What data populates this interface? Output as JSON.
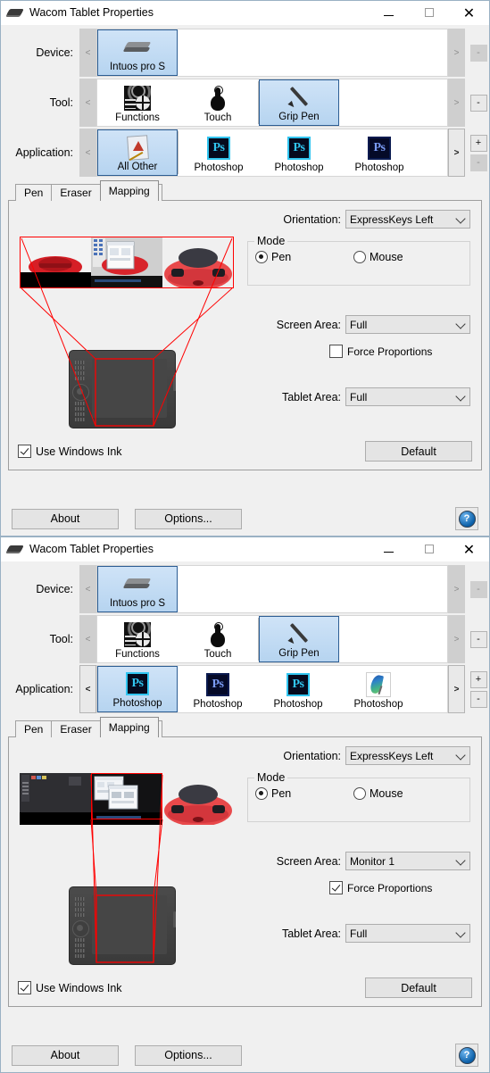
{
  "window": {
    "title": "Wacom Tablet Properties",
    "icon": "tablet-icon",
    "minimize": "—",
    "maximize": "",
    "close": "✕"
  },
  "selectors": {
    "device_label": "Device:",
    "tool_label": "Tool:",
    "application_label": "Application:",
    "prev_arrow": "<",
    "next_arrow": ">",
    "plus": "+",
    "minus": "-"
  },
  "win1": {
    "device_items": [
      {
        "label": "Intuos pro S",
        "icon": "tablet-icon",
        "selected": true
      }
    ],
    "tool_items": [
      {
        "label": "Functions",
        "icon": "functions-icon",
        "selected": false
      },
      {
        "label": "Touch",
        "icon": "touch-icon",
        "selected": false
      },
      {
        "label": "Grip Pen",
        "icon": "pen-icon",
        "selected": true
      }
    ],
    "application_items": [
      {
        "label": "All Other",
        "icon": "all-other-icon",
        "selected": true
      },
      {
        "label": "Photoshop",
        "icon": "photoshop-icon",
        "selected": false
      },
      {
        "label": "Photoshop",
        "icon": "photoshop-icon",
        "selected": false
      },
      {
        "label": "Photoshop",
        "icon": "photoshop-dark-icon",
        "selected": false
      }
    ],
    "tabs": [
      {
        "label": "Pen",
        "active": false
      },
      {
        "label": "Eraser",
        "active": false
      },
      {
        "label": "Mapping",
        "active": true
      }
    ],
    "orientation_label": "Orientation:",
    "orientation_value": "ExpressKeys Left",
    "mode_label": "Mode",
    "mode_pen": "Pen",
    "mode_mouse": "Mouse",
    "mode_selected": "Pen",
    "screen_area_label": "Screen Area:",
    "screen_area_value": "Full",
    "force_proportions_label": "Force Proportions",
    "force_proportions_checked": false,
    "tablet_area_label": "Tablet Area:",
    "tablet_area_value": "Full",
    "use_windows_ink_label": "Use Windows Ink",
    "use_windows_ink_checked": true,
    "default_button": "Default",
    "about_button": "About",
    "options_button": "Options...",
    "help_button": "?"
  },
  "win2": {
    "device_items": [
      {
        "label": "Intuos pro S",
        "icon": "tablet-icon",
        "selected": true
      }
    ],
    "tool_items": [
      {
        "label": "Functions",
        "icon": "functions-icon",
        "selected": false
      },
      {
        "label": "Touch",
        "icon": "touch-icon",
        "selected": false
      },
      {
        "label": "Grip Pen",
        "icon": "pen-icon",
        "selected": true
      }
    ],
    "application_items": [
      {
        "label": "Photoshop",
        "icon": "photoshop-icon",
        "selected": true
      },
      {
        "label": "Photoshop",
        "icon": "photoshop-dark-icon",
        "selected": false
      },
      {
        "label": "Photoshop",
        "icon": "photoshop-icon",
        "selected": false
      },
      {
        "label": "Photoshop",
        "icon": "feather-icon",
        "selected": false
      }
    ],
    "tabs": [
      {
        "label": "Pen",
        "active": false
      },
      {
        "label": "Eraser",
        "active": false
      },
      {
        "label": "Mapping",
        "active": true
      }
    ],
    "orientation_label": "Orientation:",
    "orientation_value": "ExpressKeys Left",
    "mode_label": "Mode",
    "mode_pen": "Pen",
    "mode_mouse": "Mouse",
    "mode_selected": "Pen",
    "screen_area_label": "Screen Area:",
    "screen_area_value": "Monitor 1",
    "force_proportions_label": "Force Proportions",
    "force_proportions_checked": true,
    "tablet_area_label": "Tablet Area:",
    "tablet_area_value": "Full",
    "use_windows_ink_label": "Use Windows Ink",
    "use_windows_ink_checked": true,
    "default_button": "Default",
    "about_button": "About",
    "options_button": "Options...",
    "help_button": "?"
  },
  "colors": {
    "selection_blue": "#b6d4f0",
    "selection_border": "#2c5d93",
    "mapping_red": "#ff0000",
    "panel_bg": "#f0f0f0",
    "photoshop_cyan": "#31c5f0"
  }
}
